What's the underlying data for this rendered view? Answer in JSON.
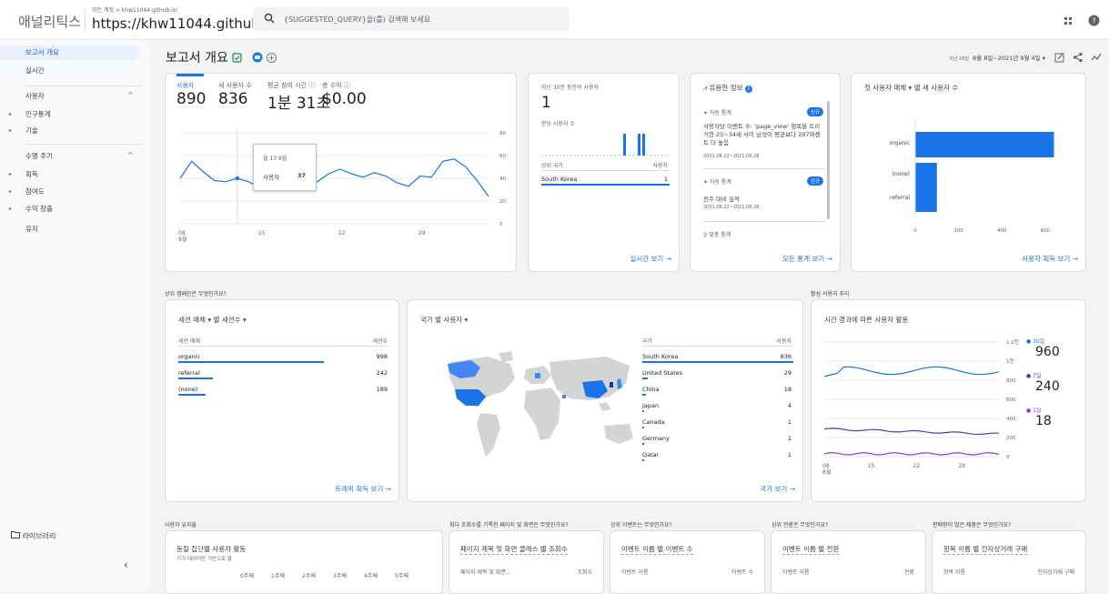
{
  "app": {
    "logo": "애널리틱스",
    "crumb": "모든 계정 > khw11044.github.io/",
    "property": "https://khw11044.github.io/",
    "search_placeholder": "{SUGGESTED_QUERY}을(를) 검색해 보세요"
  },
  "sidebar": {
    "overview": "보고서 개요",
    "realtime": "실시간",
    "users_section": "사용자",
    "demographics": "인구통계",
    "tech": "기술",
    "lifecycle_section": "수명 주기",
    "acquisition": "획득",
    "engagement": "참여도",
    "monetization": "수익 창출",
    "retention": "유지",
    "library": "라이브러리"
  },
  "page": {
    "title": "보고서 개요",
    "date_prefix": "지난 28일",
    "date_range": "8월 8일~2021년 9월 4일"
  },
  "overview_card": {
    "metrics": [
      {
        "label": "사용자",
        "value": "890"
      },
      {
        "label": "새 사용자 수",
        "value": "836"
      },
      {
        "label": "평균 참여 시간",
        "value": "1분 31초"
      },
      {
        "label": "총 수익",
        "value": "$0.00"
      }
    ],
    "y_ticks": [
      "80",
      "60",
      "40",
      "20",
      "0"
    ],
    "x_ticks": [
      "08",
      "15",
      "22",
      "29"
    ],
    "x_month": "8월",
    "tooltip_date": "월 13 8월",
    "tooltip_label": "사용자",
    "tooltip_value": "37"
  },
  "chart_data": {
    "type": "line",
    "title": "",
    "x": [
      "08-08",
      "08-09",
      "08-10",
      "08-11",
      "08-12",
      "08-13",
      "08-14",
      "08-15",
      "08-16",
      "08-17",
      "08-18",
      "08-19",
      "08-20",
      "08-21",
      "08-22",
      "08-23",
      "08-24",
      "08-25",
      "08-26",
      "08-27",
      "08-28",
      "08-29",
      "08-30",
      "08-31",
      "09-01",
      "09-02",
      "09-03",
      "09-04"
    ],
    "series": [
      {
        "name": "사용자",
        "values": [
          40,
          55,
          46,
          38,
          37,
          40,
          37,
          32,
          36,
          40,
          39,
          32,
          37,
          44,
          48,
          44,
          41,
          45,
          42,
          36,
          33,
          42,
          41,
          55,
          57,
          50,
          38,
          24
        ]
      }
    ],
    "ylim": [
      0,
      80
    ],
    "xlabel": "",
    "ylabel": ""
  },
  "realtime_card": {
    "title": "지난 30분 동안의 사용자",
    "value": "1",
    "sub": "분당 사용자 수",
    "col1": "상위 국가",
    "col2": "사용자",
    "country": "South Korea",
    "count": "1",
    "link": "실시간 보기 →"
  },
  "insights_card": {
    "title": "유용한 정보",
    "badge": "2",
    "items": [
      {
        "tag": "자동 통계",
        "new": "신규",
        "body": "사용자당 이벤트 수: 'page_view' 항목을 트리거한 25~34세 사이 남성이 평균보다 297퍼센트 더 높음",
        "date": "2021.08.22~2021.08.28"
      },
      {
        "tag": "자동 통계",
        "new": "신규",
        "body": "전주 대비 실적",
        "date": "2021.08.22~2021.08.28"
      }
    ],
    "footer": "맞춤 통계",
    "link": "모든 통계 보기 →"
  },
  "first_medium_card": {
    "title": "첫 사용자 매체 ▾ 별 새 사용자 수",
    "bars": [
      {
        "label": "organic",
        "value": 640
      },
      {
        "label": "(none)",
        "value": 100
      },
      {
        "label": "referral",
        "value": 100
      }
    ],
    "x_ticks": [
      "0",
      "200",
      "400",
      "600"
    ],
    "link": "사용자 획득 보기 →"
  },
  "sections": {
    "campaigns": "상위 캠페인은 무엇인가요?",
    "active_trend": "활성 사용자 추이",
    "retention": "사용자 유지율",
    "top_pages": "최다 조회수를 기록한 페이지 및 화면은 무엇인가요?",
    "top_events": "상위 이벤트는 무엇인가요?",
    "top_conversions": "상위 전환은 무엇인가요?",
    "top_items": "판매량이 많은 제품은 무엇인가요?"
  },
  "sessions_card": {
    "title": "세션 매체 ▾ 별 세션수 ▾",
    "col1": "세션 매체",
    "col2": "세션수",
    "rows": [
      {
        "name": "organic",
        "value": "998",
        "frac": 1.0
      },
      {
        "name": "referral",
        "value": "242",
        "frac": 0.24
      },
      {
        "name": "(none)",
        "value": "189",
        "frac": 0.19
      }
    ],
    "link": "트래픽 획득 보기 →"
  },
  "country_card": {
    "title": "국가 별 사용자 ▾",
    "col1": "국가",
    "col2": "사용자",
    "rows": [
      {
        "name": "South Korea",
        "value": "836",
        "frac": 1.0
      },
      {
        "name": "United States",
        "value": "29",
        "frac": 0.035
      },
      {
        "name": "China",
        "value": "18",
        "frac": 0.022
      },
      {
        "name": "Japan",
        "value": "4",
        "frac": 0.005
      },
      {
        "name": "Canada",
        "value": "1",
        "frac": 0.001
      },
      {
        "name": "Germany",
        "value": "1",
        "frac": 0.001
      },
      {
        "name": "Qatar",
        "value": "1",
        "frac": 0.001
      }
    ],
    "link": "국가 보기 →"
  },
  "active_card": {
    "title": "시간 경과에 따른 사용자 활동",
    "y_ticks": [
      "1.2천",
      "1천",
      "800",
      "600",
      "400",
      "200",
      "0"
    ],
    "x_ticks": [
      "08",
      "15",
      "22",
      "29"
    ],
    "x_month": "8월",
    "legend": [
      {
        "label": "30일",
        "value": "960",
        "color": "#1a73e8"
      },
      {
        "label": "7일",
        "value": "240",
        "color": "#5e35b1"
      },
      {
        "label": "1일",
        "value": "18",
        "color": "#9334e6"
      }
    ]
  },
  "bottom": {
    "retention_title": "동질 집단별 사용자 활동",
    "retention_sub": "기기 데이터만 기반으로 함",
    "weeks": [
      "0주째",
      "1주째",
      "2주째",
      "3주째",
      "4주째",
      "5주째"
    ],
    "pages_title": "페이지 제목 및 화면 클래스 별 조회수",
    "pages_col1": "페이지 제목 및 화면...",
    "pages_col2": "조회수",
    "events_title": "이벤트 이름 별 이벤트 수",
    "events_col1": "이벤트 이름",
    "events_col2": "이벤트 수",
    "conv_title": "이벤트 이름 별 전환",
    "conv_col1": "이벤트 이름",
    "conv_col2": "전환",
    "items_title": "항목 이름 별 전자상거래 구매",
    "items_col1": "항목 이름",
    "items_col2": "전자상거래 구매"
  }
}
